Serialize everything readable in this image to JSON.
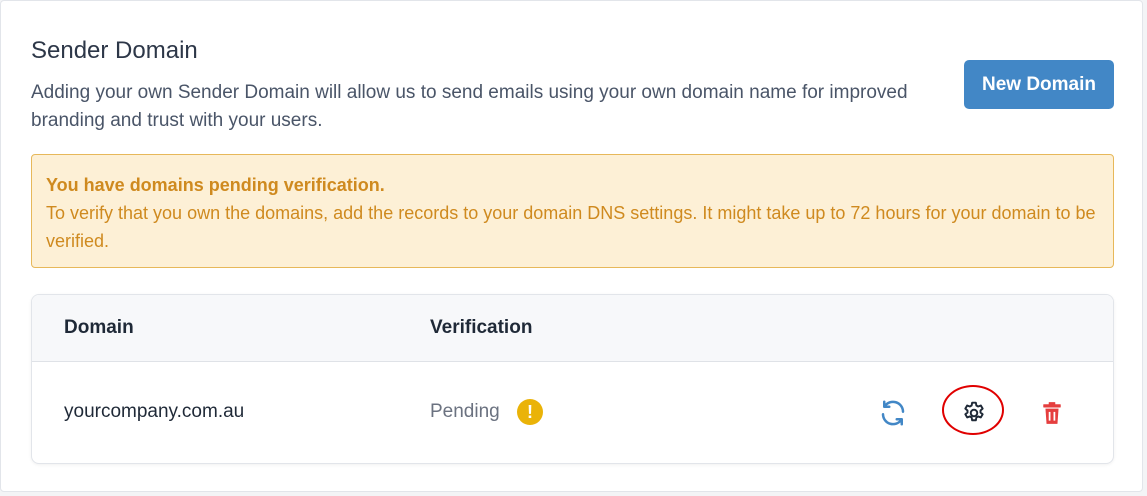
{
  "header": {
    "title": "Sender Domain",
    "description": "Adding your own Sender Domain will allow us to send emails using your own domain name for improved branding and trust with your users.",
    "new_button_label": "New Domain"
  },
  "alert": {
    "title": "You have domains pending verification.",
    "body": "To verify that you own the domains, add the records to your domain DNS settings. It might take up to 72 hours for your domain to be verified."
  },
  "table": {
    "columns": [
      "Domain",
      "Verification"
    ],
    "rows": [
      {
        "domain": "yourcompany.com.au",
        "verification": "Pending",
        "status_icon": "exclamation-icon",
        "actions": [
          "refresh-icon",
          "gear-icon",
          "trash-icon"
        ]
      }
    ]
  },
  "colors": {
    "primary": "#4287c6",
    "warning_bg": "#fdf0d6",
    "warning_text": "#cf8a1f",
    "pending_icon": "#eab308",
    "danger": "#e53e3e",
    "highlight": "#e00000"
  }
}
